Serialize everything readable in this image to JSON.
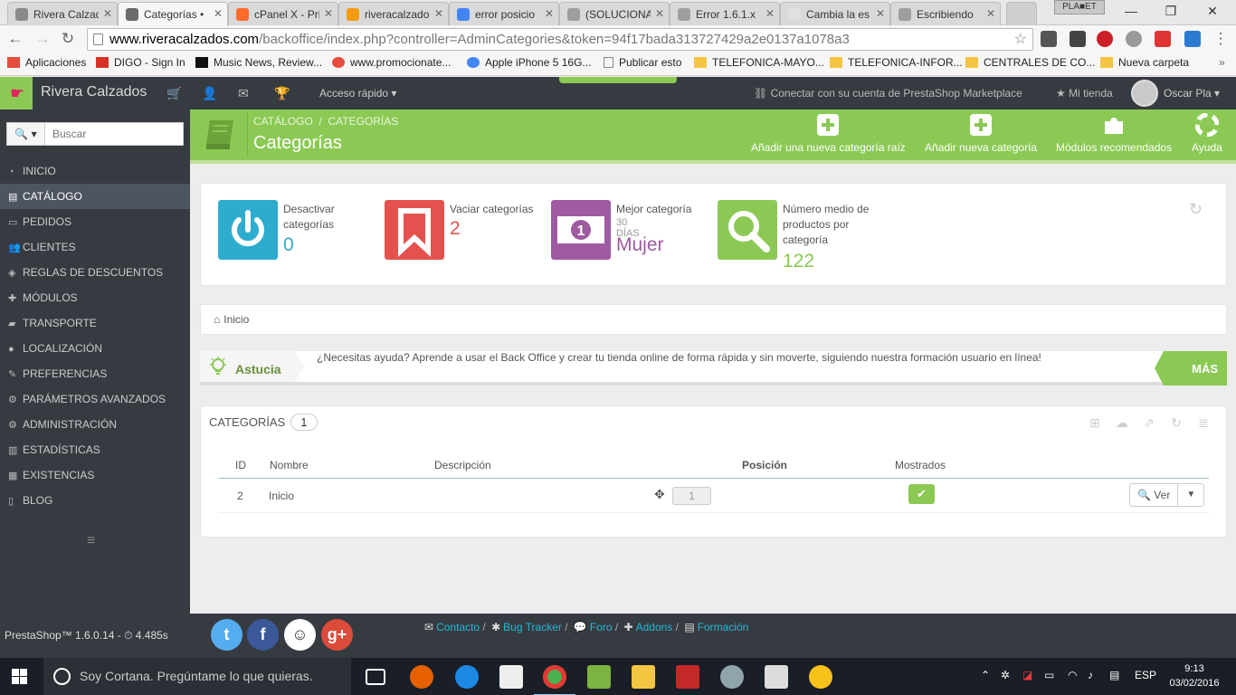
{
  "browser": {
    "tabs": [
      {
        "title": "Rivera Calzad",
        "active": false,
        "favicon_color": "#8a8a8a"
      },
      {
        "title": "Categorías •",
        "active": true,
        "favicon_color": "#6b6b6b"
      },
      {
        "title": "cPanel X - Pri",
        "active": false,
        "favicon_color": "#ff6c2c"
      },
      {
        "title": "riveracalzado",
        "active": false,
        "favicon_color": "#f39c12"
      },
      {
        "title": "error posicio",
        "active": false,
        "favicon_color": "#4285f4"
      },
      {
        "title": "(SOLUCIONA",
        "active": false,
        "favicon_color": "#9e9e9e"
      },
      {
        "title": "Error 1.6.1.x",
        "active": false,
        "favicon_color": "#9e9e9e"
      },
      {
        "title": "Cambia la es",
        "active": false,
        "favicon_color": "#e0e0e0"
      },
      {
        "title": "Escribiendo",
        "active": false,
        "favicon_color": "#9e9e9e"
      }
    ],
    "window_user": "PLA■ET",
    "url_host": "www.riveracalzados.com",
    "url_path": "/backoffice/index.php?controller=AdminCategories&token=94f17bada313727429a2e0137a1078a3",
    "bookmarks": [
      {
        "label": "Aplicaciones",
        "icon": "apps-icon",
        "color": "#e74c3c"
      },
      {
        "label": "DIGO - Sign In",
        "icon": "gmail-icon",
        "color": "#d93025"
      },
      {
        "label": "Music News, Review...",
        "icon": "b-icon",
        "color": "#111111"
      },
      {
        "label": "www.promocionate...",
        "icon": "circle-icon",
        "color": "#e74c3c"
      },
      {
        "label": "Apple iPhone 5 16G...",
        "icon": "google-icon",
        "color": "#4285f4"
      },
      {
        "label": "Publicar esto",
        "icon": "page-icon",
        "color": "#888888"
      },
      {
        "label": "TELEFONICA-MAYO...",
        "icon": "folder-icon",
        "color": "#f4c542"
      },
      {
        "label": "TELEFONICA-INFOR...",
        "icon": "folder-icon",
        "color": "#f4c542"
      },
      {
        "label": "CENTRALES DE CO...",
        "icon": "folder-icon",
        "color": "#f4c542"
      },
      {
        "label": "Nueva carpeta",
        "icon": "folder-icon",
        "color": "#f4c542"
      }
    ]
  },
  "header": {
    "shop_name": "Rivera Calzados",
    "quick_access": "Acceso rápido",
    "marketplace": "Conectar con su cuenta de PrestaShop Marketplace",
    "my_shop": "Mi tienda",
    "user_name": "Oscar Pla"
  },
  "sidebar": {
    "search_placeholder": "Buscar",
    "items": [
      {
        "label": "Inicio",
        "icon": "dashboard-icon"
      },
      {
        "label": "Catálogo",
        "icon": "book-icon",
        "active": true
      },
      {
        "label": "Pedidos",
        "icon": "credit-card-icon"
      },
      {
        "label": "Clientes",
        "icon": "users-icon"
      },
      {
        "label": "Reglas de descuentos",
        "icon": "tags-icon"
      },
      {
        "label": "Módulos",
        "icon": "puzzle-icon"
      },
      {
        "label": "Transporte",
        "icon": "truck-icon"
      },
      {
        "label": "Localización",
        "icon": "globe-icon"
      },
      {
        "label": "Preferencias",
        "icon": "wrench-icon"
      },
      {
        "label": "Parámetros avanzados",
        "icon": "cogs-icon"
      },
      {
        "label": "Administración",
        "icon": "cog-icon"
      },
      {
        "label": "Estadísticas",
        "icon": "bar-chart-icon"
      },
      {
        "label": "Existencias",
        "icon": "archive-icon"
      },
      {
        "label": "Blog",
        "icon": "file-icon"
      }
    ]
  },
  "page": {
    "breadcrumb_parent": "Catálogo",
    "breadcrumb_current": "Categorías",
    "title": "Categorías",
    "toolbar": [
      {
        "label": "Añadir una nueva categoría raíz",
        "icon": "plus-square-icon"
      },
      {
        "label": "Añadir nueva categoría",
        "icon": "plus-square-icon"
      },
      {
        "label": "Módulos recomendados",
        "icon": "puzzle-icon"
      },
      {
        "label": "Ayuda",
        "icon": "lifebuoy-icon"
      }
    ]
  },
  "kpis": [
    {
      "label": "Desactivar categorías",
      "sublabel": "",
      "value": "0",
      "color": "#2eacce",
      "value_color": "#2eacce",
      "icon": "power-icon"
    },
    {
      "label": "Vaciar categorías",
      "sublabel": "",
      "value": "2",
      "color": "#e5524e",
      "value_color": "#e5524e",
      "icon": "bookmark-icon"
    },
    {
      "label": "Mejor categoría",
      "sublabel": "30 DÍAS",
      "value": "Mujer",
      "color": "#9e5ba1",
      "value_color": "#9e5ba1",
      "icon": "money-icon"
    },
    {
      "label": "Número medio de productos por categoría",
      "sublabel": "",
      "value": "122",
      "color": "#8bc954",
      "value_color": "#8bc954",
      "icon": "search-icon"
    }
  ],
  "breadcrumb": {
    "home": "Inicio"
  },
  "tip": {
    "label": "Astucia",
    "text": "¿Necesitas ayuda? Aprende a usar el Back Office y crear tu tienda online de forma rápida y sin moverte, siguiendo nuestra formación usuario en línea!",
    "more": "MÁS"
  },
  "list": {
    "title": "Categorías",
    "count": "1",
    "columns": {
      "id": "ID",
      "name": "Nombre",
      "description": "Descripción",
      "position": "Posición",
      "displayed": "Mostrados"
    },
    "rows": [
      {
        "id": "2",
        "name": "Inicio",
        "description": "",
        "position": "1",
        "displayed": true,
        "action": "Ver"
      }
    ]
  },
  "footer": {
    "version": "PrestaShop™ 1.6.0.14 - ⏱ 4.485s",
    "links": [
      "Contacto",
      "Bug Tracker",
      "Foro",
      "Addons",
      "Formación"
    ]
  },
  "taskbar": {
    "cortana_placeholder": "Soy Cortana. Pregúntame lo que quieras.",
    "language": "ESP",
    "time": "9:13",
    "date": "03/02/2016"
  }
}
